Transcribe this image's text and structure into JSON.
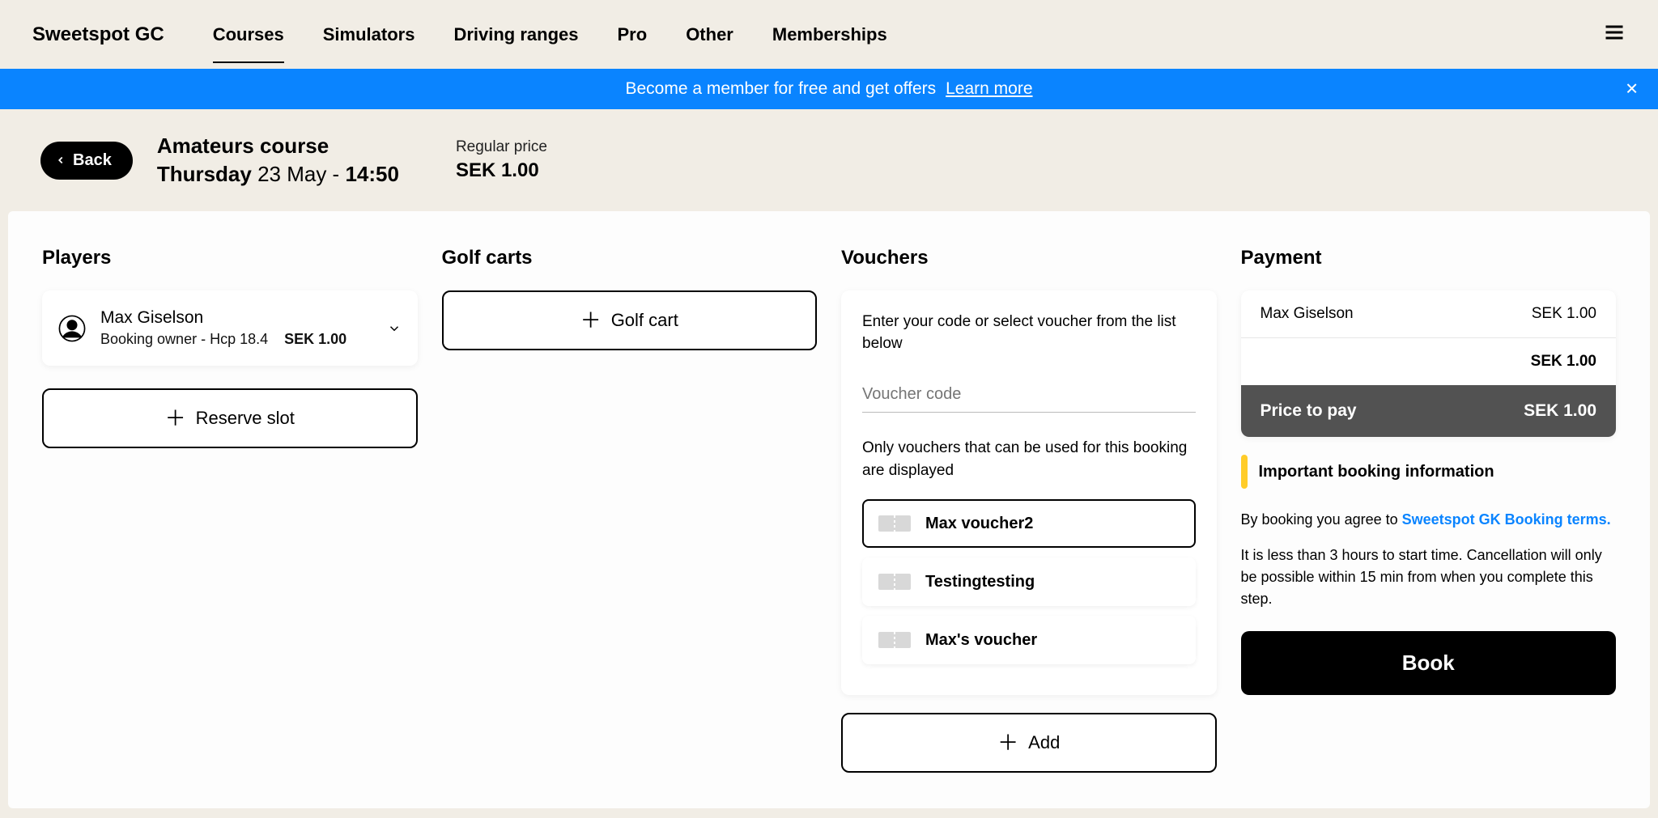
{
  "brand": "Sweetspot GC",
  "nav": {
    "items": [
      {
        "label": "Courses",
        "active": true
      },
      {
        "label": "Simulators",
        "active": false
      },
      {
        "label": "Driving ranges",
        "active": false
      },
      {
        "label": "Pro",
        "active": false
      },
      {
        "label": "Other",
        "active": false
      },
      {
        "label": "Memberships",
        "active": false
      }
    ]
  },
  "banner": {
    "text": "Become a member for free and get offers",
    "link": "Learn more"
  },
  "header": {
    "back": "Back",
    "course_name": "Amateurs course",
    "day": "Thursday",
    "date_rest": " 23 May - ",
    "time": "14:50",
    "price_label": "Regular price",
    "price_value": "SEK 1.00"
  },
  "sections": {
    "players_title": "Players",
    "carts_title": "Golf carts",
    "vouchers_title": "Vouchers",
    "payment_title": "Payment"
  },
  "player": {
    "name": "Max Giselson",
    "sub1": "Booking owner - Hcp 18.4",
    "sub_price": "SEK 1.00"
  },
  "reserve_label": "Reserve slot",
  "cart_label": "Golf cart",
  "vouchers": {
    "desc": "Enter your code or select voucher from the list below",
    "placeholder": "Voucher code",
    "note": "Only vouchers that can be used for this booking are displayed",
    "items": [
      {
        "label": "Max voucher2",
        "selected": true
      },
      {
        "label": "Testingtesting",
        "selected": false
      },
      {
        "label": "Max's voucher",
        "selected": false
      }
    ],
    "add_label": "Add"
  },
  "payment": {
    "name": "Max Giselson",
    "amount": "SEK 1.00",
    "subtotal": "SEK 1.00",
    "pay_label": "Price to pay",
    "pay_amount": "SEK 1.00",
    "important": "Important booking information",
    "agree_prefix": "By booking you agree to ",
    "agree_link": "Sweetspot GK Booking terms.",
    "cancel_text": "It is less than 3 hours to start time. Cancellation will only be possible within 15 min from when you complete this step.",
    "book_label": "Book"
  }
}
